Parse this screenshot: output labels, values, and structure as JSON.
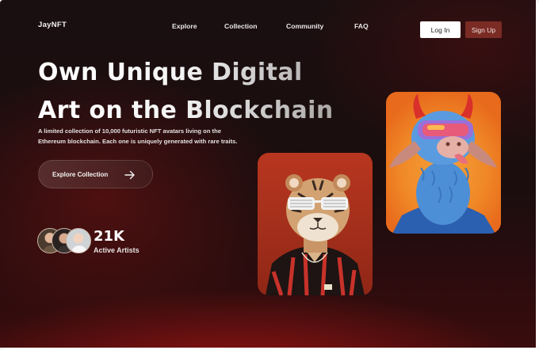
{
  "brand": {
    "logo": "JayNFT"
  },
  "nav": {
    "items": [
      "Explore",
      "Collection",
      "Community",
      "FAQ"
    ]
  },
  "auth": {
    "login_label": "Log In",
    "signup_label": "Sign Up"
  },
  "hero": {
    "headline_lines": [
      "Own Unique Digital",
      "Art on the Blockchain"
    ],
    "description_lines": [
      "A limited collection of 10,000 futuristic NFT avatars living on the",
      "Ethereum blockchain. Each one is uniquely generated with rare traits."
    ],
    "cta_label": "Explore Collection",
    "cta_icon": "arrow-right-icon"
  },
  "stats": {
    "count": "21K",
    "label": "Active Artists"
  },
  "colors": {
    "accent": "#7a2b24",
    "background": "#1a0f10",
    "card_tiger_bg": "#b8361f",
    "card_lama_bg": "#f08827"
  },
  "cards": [
    {
      "name": "tiger-nft-card"
    },
    {
      "name": "llama-nft-card"
    }
  ]
}
